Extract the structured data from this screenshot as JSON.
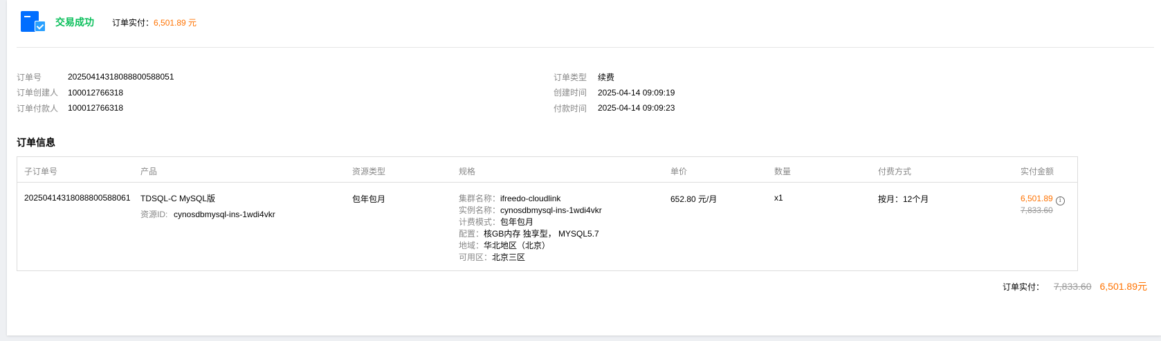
{
  "header": {
    "status": "交易成功",
    "paid_label": "订单实付：",
    "paid_value": "6,501.89 元"
  },
  "meta_left": [
    {
      "label": "订单号",
      "value": "20250414318088800588051"
    },
    {
      "label": "订单创建人",
      "value": "100012766318"
    },
    {
      "label": "订单付款人",
      "value": "100012766318"
    }
  ],
  "meta_right": [
    {
      "label": "订单类型",
      "value": "续费"
    },
    {
      "label": "创建时间",
      "value": "2025-04-14 09:09:19"
    },
    {
      "label": "付款时间",
      "value": "2025-04-14 09:09:23"
    }
  ],
  "section_title": "订单信息",
  "table": {
    "headers": [
      "子订单号",
      "产品",
      "资源类型",
      "规格",
      "单价",
      "数量",
      "付费方式",
      "实付金额"
    ],
    "row": {
      "sub_order_id": "20250414318088800588061",
      "product_name": "TDSQL-C MySQL版",
      "resource_id_label": "资源ID:",
      "resource_id": "cynosdbmysql-ins-1wdi4vkr",
      "resource_type": "包年包月",
      "spec": [
        {
          "label": "集群名称：",
          "value": "ifreedo-cloudlink"
        },
        {
          "label": "实例名称：",
          "value": "cynosdbmysql-ins-1wdi4vkr"
        },
        {
          "label": "计费模式：",
          "value": "包年包月"
        },
        {
          "label": "配置：",
          "value": "核GB内存 独享型， MYSQL5.7"
        },
        {
          "label": "地域：",
          "value": "华北地区（北京）"
        },
        {
          "label": "可用区：",
          "value": "北京三区"
        }
      ],
      "unit_price": "652.80 元/月",
      "quantity": "x1",
      "payment": "按月：12个月",
      "paid_amount": "6,501.89",
      "original_amount": "7,833.60"
    }
  },
  "total": {
    "label": "订单实付：",
    "original": "7,833.60",
    "final": "6,501.89元"
  }
}
